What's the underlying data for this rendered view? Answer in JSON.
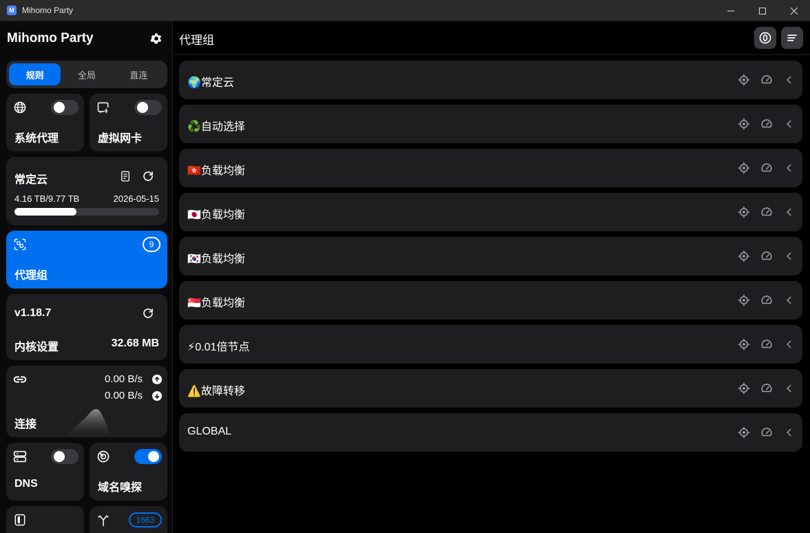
{
  "window": {
    "title": "Mihomo Party",
    "logo_letter": "M"
  },
  "sidebar": {
    "brand": "Mihomo Party",
    "modes": [
      {
        "label": "规则",
        "active": true
      },
      {
        "label": "全局",
        "active": false
      },
      {
        "label": "直连",
        "active": false
      }
    ],
    "system_proxy": {
      "label": "系统代理",
      "enabled": false
    },
    "virtual_nic": {
      "label": "虚拟网卡",
      "enabled": false
    },
    "profile": {
      "name": "常定云",
      "usage": "4.16 TB/9.77 TB",
      "expire": "2026-05-15",
      "usage_fraction": 0.43
    },
    "proxy_groups_card": {
      "label": "代理组",
      "count": "9"
    },
    "core": {
      "version": "v1.18.7",
      "label": "内核设置",
      "memory": "32.68 MB"
    },
    "connections": {
      "label": "连接",
      "upload": "0.00 B/s",
      "download": "0.00 B/s"
    },
    "dns": {
      "label": "DNS",
      "enabled": false
    },
    "sniffer": {
      "label": "域名嗅探",
      "enabled": true
    },
    "rules_count": "1663"
  },
  "main": {
    "title": "代理组",
    "groups": [
      {
        "name": "🌍常定云"
      },
      {
        "name": "♻️自动选择"
      },
      {
        "name": "🇭🇰负载均衡"
      },
      {
        "name": "🇯🇵负载均衡"
      },
      {
        "name": "🇰🇷负载均衡"
      },
      {
        "name": "🇸🇬负载均衡"
      },
      {
        "name": "⚡0.01倍节点"
      },
      {
        "name": "⚠️故障转移"
      },
      {
        "name": "GLOBAL"
      }
    ]
  },
  "colors": {
    "accent": "#006ff0",
    "card": "#1e1e20",
    "background": "#000000"
  }
}
